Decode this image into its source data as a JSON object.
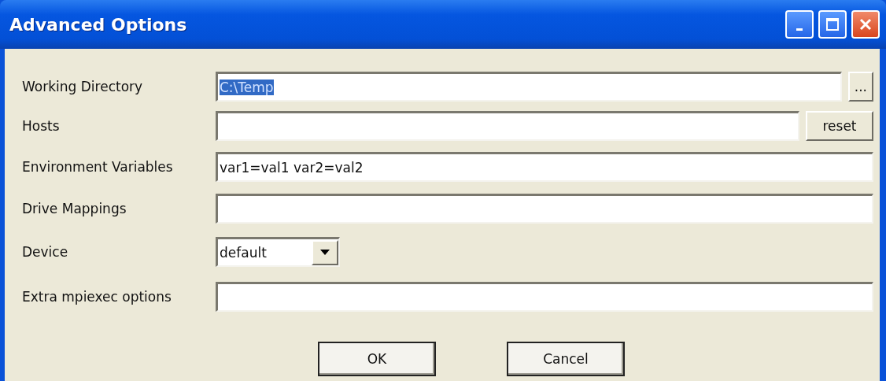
{
  "window": {
    "title": "Advanced Options"
  },
  "rows": [
    {
      "kind": "text_button",
      "label": "Working Directory",
      "value": "C:\\Temp",
      "highlighted": true,
      "button": "..."
    },
    {
      "kind": "text_button",
      "label": "Hosts",
      "button": "reset"
    },
    {
      "kind": "text",
      "label": "Environment Variables",
      "value": "var1=val1 var2=val2"
    },
    {
      "kind": "text",
      "label": "Drive Mappings"
    },
    {
      "kind": "select",
      "label": "Device",
      "value": "default"
    },
    {
      "kind": "text",
      "label": "Extra mpiexec options"
    }
  ],
  "buttons": [
    "OK",
    "Cancel"
  ]
}
